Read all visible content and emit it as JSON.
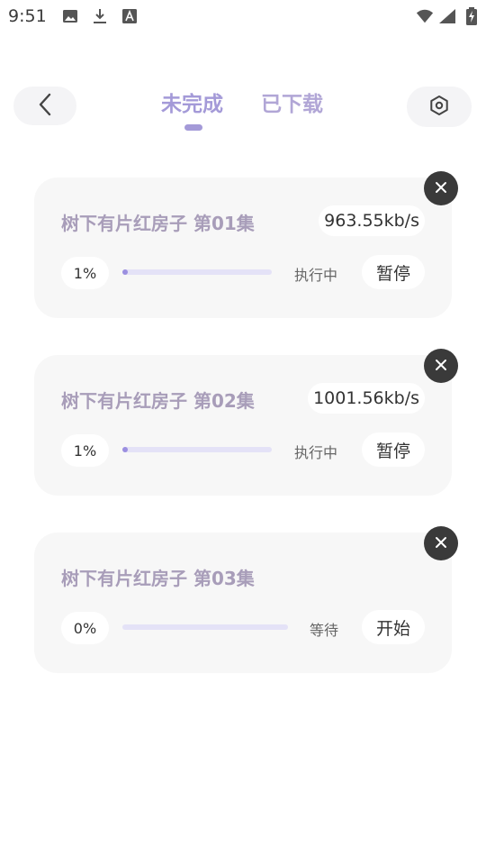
{
  "status_bar": {
    "time": "9:51",
    "icons_left": [
      "image-icon",
      "download-icon",
      "font-a-icon"
    ],
    "icons_right": [
      "wifi-icon",
      "signal-icon",
      "battery-charging-icon"
    ]
  },
  "header": {
    "tabs": [
      {
        "label": "未完成",
        "active": true
      },
      {
        "label": "已下载",
        "active": false
      }
    ],
    "back_icon": "chevron-left-icon",
    "settings_icon": "settings-hexagon-icon"
  },
  "downloads": [
    {
      "title": "树下有片红房子 第01集",
      "speed": "963.55kb/s",
      "percent_text": "1%",
      "progress": 0.01,
      "state": "执行中",
      "action": "暂停"
    },
    {
      "title": "树下有片红房子 第02集",
      "speed": "1001.56kb/s",
      "percent_text": "1%",
      "progress": 0.01,
      "state": "执行中",
      "action": "暂停"
    },
    {
      "title": "树下有片红房子 第03集",
      "speed": "",
      "percent_text": "0%",
      "progress": 0.0,
      "state": "等待",
      "action": "开始"
    }
  ],
  "colors": {
    "accent": "#a49ad8",
    "card_bg": "#f7f7f7",
    "close_bg": "#3a3a3a",
    "title_text": "#a89db9",
    "progress_track": "#e4e2f7",
    "progress_fill": "#9b8fe0"
  }
}
